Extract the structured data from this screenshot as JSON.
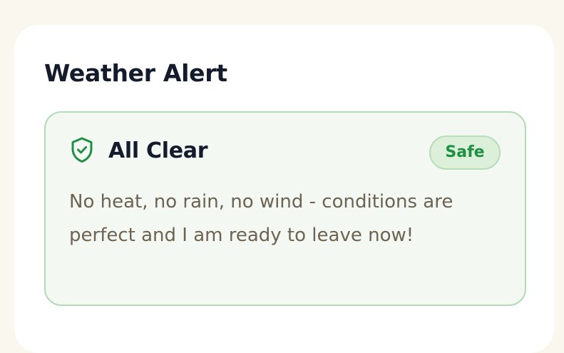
{
  "card": {
    "title": "Weather Alert"
  },
  "alert": {
    "icon": "shield-check-icon",
    "title": "All Clear",
    "badge": "Safe",
    "message": "No heat, no rain, no wind - conditions are perfect and I am ready to leave now!"
  },
  "colors": {
    "page_background": "#faf8ee",
    "alert_background": "#f3f8f2",
    "alert_border": "#b4dab8",
    "accent_green": "#1f8f45",
    "heading_text": "#141b2d",
    "body_text": "#6d6352"
  }
}
